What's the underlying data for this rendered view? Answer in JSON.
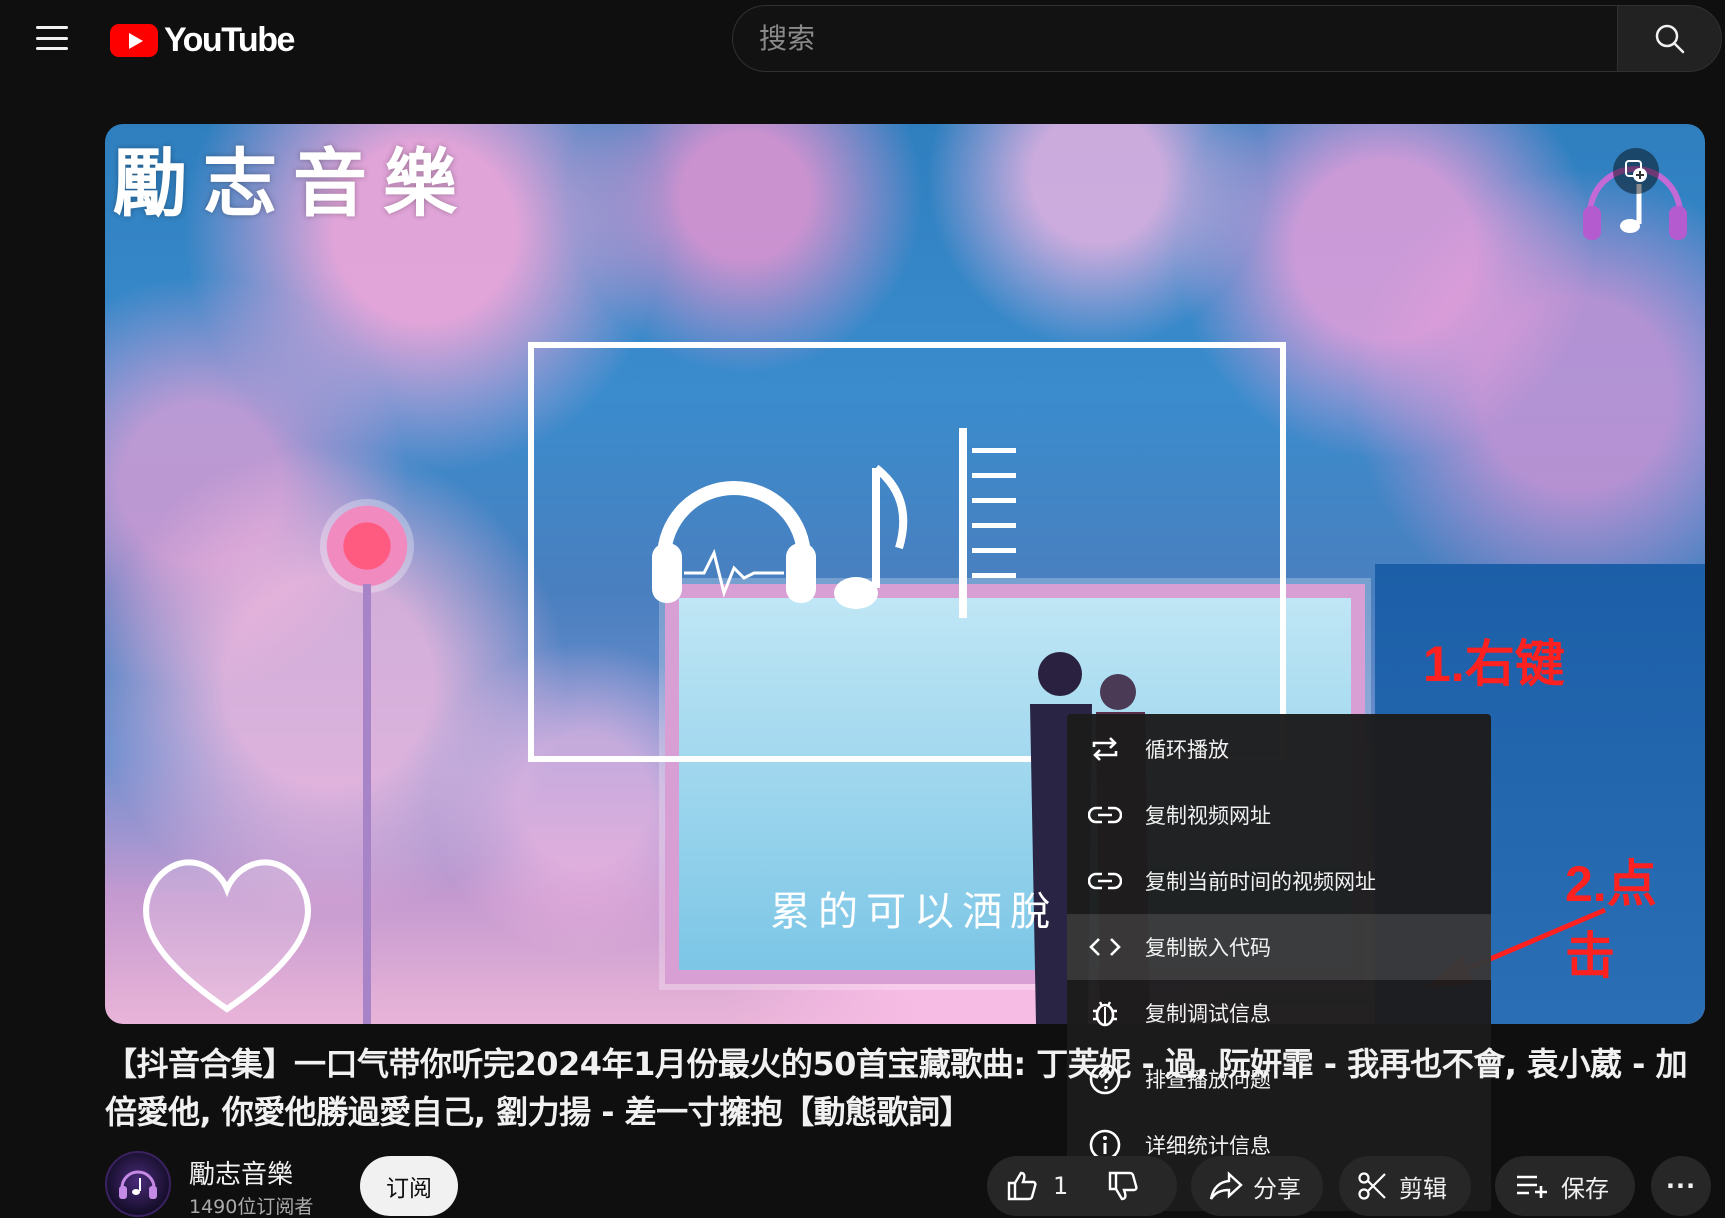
{
  "header": {
    "logo_text": "YouTube",
    "search_placeholder": "搜索"
  },
  "player": {
    "watermark_channel": "勵志音樂",
    "lyric_line": "累的可以洒脫"
  },
  "annotations": {
    "step1": "1.右键",
    "step2": "2.点击"
  },
  "context_menu": {
    "items": [
      {
        "label": "循环播放",
        "icon": "loop-icon"
      },
      {
        "label": "复制视频网址",
        "icon": "link-icon"
      },
      {
        "label": "复制当前时间的视频网址",
        "icon": "link-icon"
      },
      {
        "label": "复制嵌入代码",
        "icon": "code-icon",
        "highlighted": true
      },
      {
        "label": "复制调试信息",
        "icon": "bug-icon"
      },
      {
        "label": "排查播放问题",
        "icon": "help-icon"
      },
      {
        "label": "详细统计信息",
        "icon": "info-icon"
      }
    ]
  },
  "video": {
    "title": "【抖音合集】一口气带你听完2024年1月份最火的50首宝藏歌曲: 丁芙妮 - 過, 阮妍霏 - 我再也不會, 袁小葳 - 加倍愛他, 你愛他勝過愛自己, 劉力揚 - 差一寸擁抱【動態歌詞】",
    "channel_name": "勵志音樂",
    "subscribers": "1490位订阅者",
    "subscribe_label": "订阅",
    "like_count": "1",
    "share_label": "分享",
    "clip_label": "剪辑",
    "save_label": "保存",
    "more_label": "···"
  },
  "colors": {
    "background": "#0f0f0f",
    "brand_red": "#ff0000",
    "annotation_red": "#ff2020",
    "menu_bg": "#1c1c1c"
  }
}
